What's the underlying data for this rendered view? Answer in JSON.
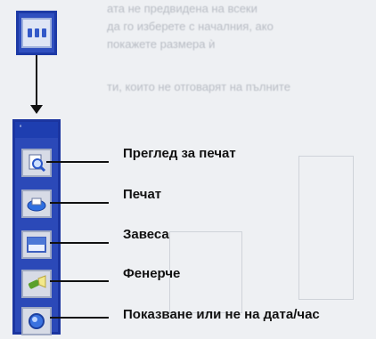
{
  "toolbar": {
    "title": "'",
    "items": [
      {
        "icon": "print-preview-icon",
        "label": "Преглед за печат"
      },
      {
        "icon": "printer-icon",
        "label": "Печат"
      },
      {
        "icon": "curtain-icon",
        "label": "Завеса"
      },
      {
        "icon": "flashlight-icon",
        "label": "Фенерче"
      },
      {
        "icon": "clock-icon",
        "label": "Показване или не на дата/час"
      }
    ]
  },
  "background": {
    "line1": "ата не предвидена на всеки",
    "line2": "да го изберете с началния, ако",
    "line3": "покажете размера ѝ",
    "line4": "ти, които не отговарят на пълните"
  }
}
